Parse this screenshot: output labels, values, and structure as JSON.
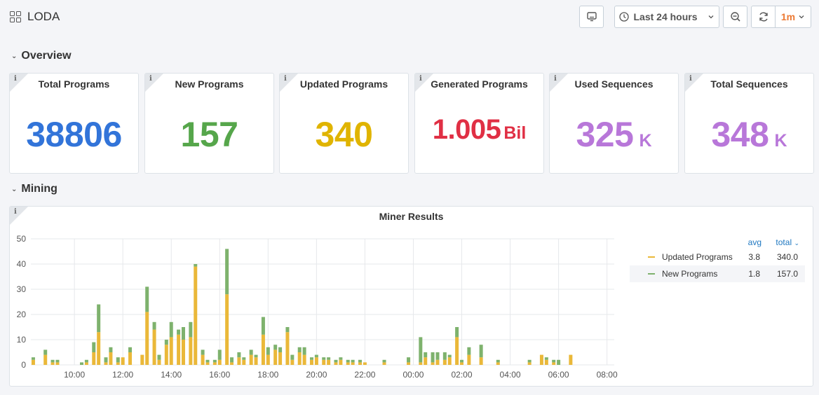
{
  "header": {
    "title": "LODA",
    "time_range": "Last 24 hours",
    "refresh_interval": "1m"
  },
  "rows": {
    "overview": "Overview",
    "mining": "Mining"
  },
  "stats": [
    {
      "title": "Total Programs",
      "value": "38806",
      "unit": "",
      "color": "#3274d9"
    },
    {
      "title": "New Programs",
      "value": "157",
      "unit": "",
      "color": "#56a64b"
    },
    {
      "title": "Updated Programs",
      "value": "340",
      "unit": "",
      "color": "#e0b400"
    },
    {
      "title": "Generated Programs",
      "value": "1.005",
      "unit": "Bil",
      "color": "#e02f44"
    },
    {
      "title": "Used Sequences",
      "value": "325",
      "unit": "K",
      "color": "#b877d9"
    },
    {
      "title": "Total Sequences",
      "value": "348",
      "unit": "K",
      "color": "#b877d9"
    }
  ],
  "chart": {
    "title": "Miner Results",
    "legend": {
      "avg_label": "avg",
      "total_label": "total",
      "items": [
        {
          "name": "Updated Programs",
          "color": "#eab839",
          "avg": "3.8",
          "total": "340.0"
        },
        {
          "name": "New Programs",
          "color": "#7eb26d",
          "avg": "1.8",
          "total": "157.0"
        }
      ]
    }
  },
  "chart_data": {
    "type": "bar",
    "stacked": true,
    "title": "Miner Results",
    "ylim": [
      0,
      50
    ],
    "yticks": [
      0,
      10,
      20,
      30,
      40,
      50
    ],
    "xlim_hours": [
      8.2,
      8.3
    ],
    "xticks": [
      "10:00",
      "12:00",
      "14:00",
      "16:00",
      "18:00",
      "20:00",
      "22:00",
      "00:00",
      "02:00",
      "04:00",
      "06:00",
      "08:00"
    ],
    "x_hours": [
      8.3,
      8.8,
      9.1,
      9.3,
      10.3,
      10.5,
      10.8,
      11.0,
      11.3,
      11.5,
      11.8,
      12.0,
      12.3,
      12.8,
      13.0,
      13.3,
      13.5,
      13.8,
      14.0,
      14.3,
      14.5,
      14.8,
      15.0,
      15.3,
      15.5,
      15.8,
      16.0,
      16.3,
      16.5,
      16.8,
      17.0,
      17.3,
      17.5,
      17.8,
      18.0,
      18.3,
      18.5,
      18.8,
      19.0,
      19.3,
      19.5,
      19.8,
      20.0,
      20.3,
      20.5,
      20.8,
      21.0,
      21.3,
      21.5,
      21.8,
      22.0,
      22.8,
      23.8,
      24.3,
      24.5,
      24.8,
      25.0,
      25.3,
      25.5,
      25.8,
      26.0,
      26.3,
      26.8,
      27.5,
      28.8,
      29.3,
      29.5,
      29.8,
      30.0,
      30.5
    ],
    "series": [
      {
        "name": "Updated Programs",
        "color": "#eab839",
        "values": [
          2,
          4,
          1,
          1,
          0,
          1,
          5,
          13,
          1,
          5,
          1,
          3,
          5,
          4,
          21,
          14,
          2,
          8,
          11,
          12,
          10,
          11,
          39,
          4,
          1,
          1,
          2,
          28,
          1,
          3,
          2,
          4,
          3,
          12,
          4,
          6,
          5,
          13,
          2,
          5,
          4,
          2,
          3,
          2,
          2,
          1,
          2,
          1,
          1,
          1,
          1,
          1,
          1,
          1,
          3,
          1,
          2,
          2,
          3,
          11,
          1,
          4,
          3,
          1,
          1,
          4,
          2,
          1,
          0,
          4
        ]
      },
      {
        "name": "New Programs",
        "color": "#7eb26d",
        "values": [
          1,
          2,
          1,
          1,
          1,
          1,
          4,
          11,
          2,
          2,
          2,
          0,
          2,
          0,
          10,
          3,
          2,
          2,
          6,
          2,
          5,
          6,
          1,
          2,
          1,
          1,
          4,
          18,
          2,
          2,
          1,
          2,
          1,
          7,
          3,
          2,
          2,
          2,
          2,
          2,
          3,
          1,
          1,
          1,
          1,
          1,
          1,
          1,
          1,
          1,
          0,
          1,
          2,
          10,
          2,
          4,
          3,
          3,
          1,
          4,
          1,
          3,
          5,
          1,
          1,
          0,
          1,
          1,
          2,
          0
        ]
      }
    ]
  }
}
